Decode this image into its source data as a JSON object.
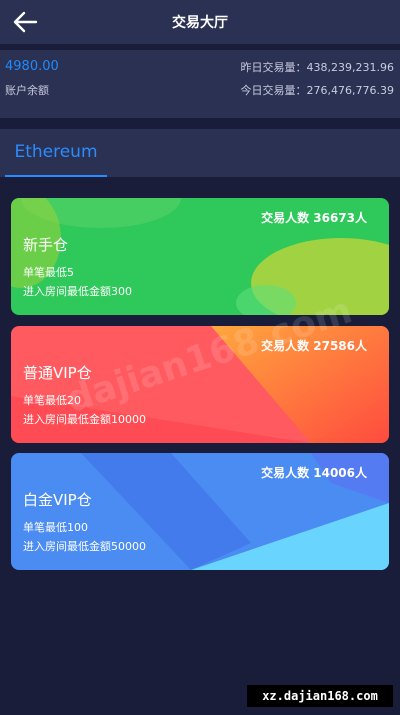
{
  "header": {
    "title": "交易大厅",
    "back_icon": "arrow-left-icon"
  },
  "account": {
    "balance": "4980.00",
    "balance_label": "账户余额",
    "yesterday_volume": "昨日交易量：438,239,231.96",
    "today_volume": "今日交易量：276,476,776.39"
  },
  "tabs": [
    {
      "label": "Ethereum",
      "active": true
    }
  ],
  "rooms": [
    {
      "name": "新手仓",
      "count": "交易人数 36673人",
      "min_bet": "单笔最低5",
      "entry": "进入房间最低金额300",
      "color": "#2fc85a"
    },
    {
      "name": "普通VIP仓",
      "count": "交易人数 27586人",
      "min_bet": "单笔最低20",
      "entry": "进入房间最低金额10000",
      "color": "#ff5a5f"
    },
    {
      "name": "白金VIP仓",
      "count": "交易人数 14006人",
      "min_bet": "单笔最低100",
      "entry": "进入房间最低金额50000",
      "color": "#4b8cf2"
    }
  ],
  "watermark": "dajian168.com",
  "footer_badge": "xz.dajian168.com",
  "colors": {
    "background": "#1a1d3a",
    "panel": "#2b3152",
    "accent": "#1f8bff"
  }
}
